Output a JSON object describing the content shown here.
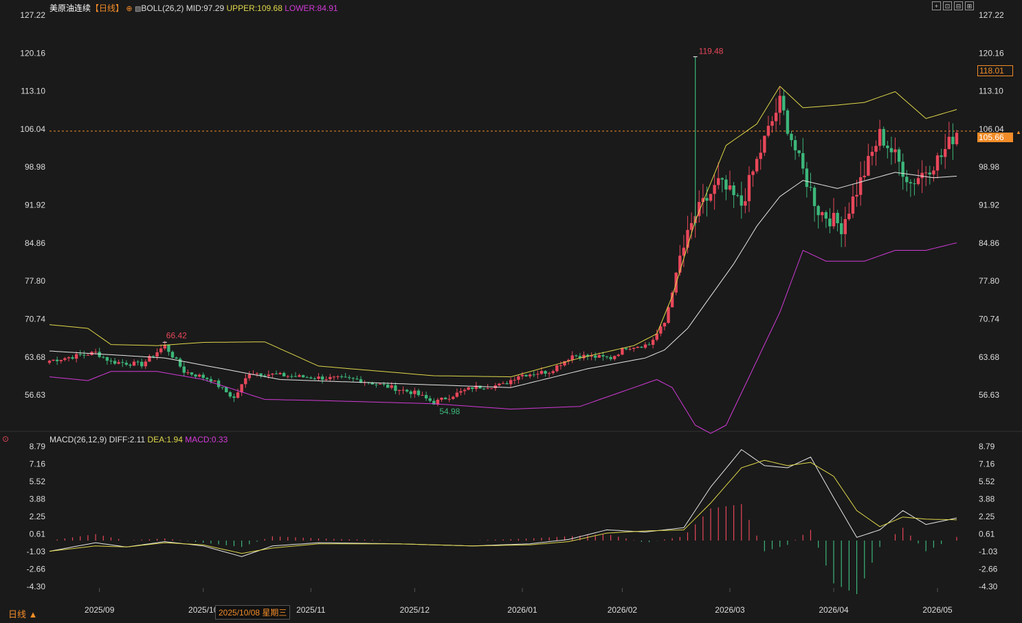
{
  "header": {
    "symbol": "美原油连续",
    "period_tag": "【日线】",
    "boll_label": "BOLL(26,2)",
    "mid": "MID:97.29",
    "upper": "UPPER:109.68",
    "lower": "LOWER:84.91",
    "macd_label": "MACD(26,12,9)",
    "diff": "DIFF:2.11",
    "dea": "DEA:1.94",
    "macd": "MACD:0.33"
  },
  "footer": {
    "timeframe": "日线 ▲",
    "cursor_date": "2025/10/08 星期三"
  },
  "colors": {
    "up": "#e8475a",
    "down": "#3cb67a",
    "mid": "#e8e8e8",
    "upper": "#e0d84a",
    "lower": "#d23ad8",
    "current": "#f28c28",
    "grid": "#2a2a2a"
  },
  "price_tags": {
    "high_label": "118.01",
    "last_label": "105.66",
    "max_marker": "119.48",
    "min_marker": "54.98",
    "local_high": "66.42"
  },
  "chart_data": [
    {
      "type": "candlestick",
      "y_ticks": [
        "127.22",
        "120.16",
        "113.10",
        "106.04",
        "98.98",
        "91.92",
        "84.86",
        "77.80",
        "70.74",
        "63.68",
        "56.63"
      ],
      "ylim": [
        52.5,
        127.22
      ],
      "x_ticks": [
        "2025/09",
        "2025/10",
        "2025/11",
        "2025/12",
        "2026/01",
        "2026/02",
        "2026/03",
        "2026/04",
        "2026/05"
      ],
      "last_price": 105.66,
      "waypoints": [
        [
          0,
          63.0
        ],
        [
          12,
          64.5
        ],
        [
          16,
          62.8
        ],
        [
          24,
          62.3
        ],
        [
          30,
          65.8
        ],
        [
          35,
          61.0
        ],
        [
          42,
          59.5
        ],
        [
          48,
          56.0
        ],
        [
          52,
          60.8
        ],
        [
          65,
          60.0
        ],
        [
          80,
          59.5
        ],
        [
          95,
          57.0
        ],
        [
          100,
          55.2
        ],
        [
          110,
          58.0
        ],
        [
          118,
          58.5
        ],
        [
          122,
          60.3
        ],
        [
          130,
          61.0
        ],
        [
          136,
          64.0
        ],
        [
          146,
          63.5
        ],
        [
          150,
          65.5
        ],
        [
          156,
          66.0
        ],
        [
          160,
          70.0
        ],
        [
          164,
          82.0
        ],
        [
          168,
          90.0
        ],
        [
          174,
          96.0
        ],
        [
          180,
          92.0
        ],
        [
          186,
          104.0
        ],
        [
          190,
          111.0
        ],
        [
          195,
          100.0
        ],
        [
          200,
          91.0
        ],
        [
          206,
          88.0
        ],
        [
          212,
          98.0
        ],
        [
          216,
          105.0
        ],
        [
          220,
          101.0
        ],
        [
          224,
          96.0
        ],
        [
          232,
          101.0
        ],
        [
          236,
          105.66
        ]
      ],
      "series": [
        {
          "name": "MID",
          "points": [
            [
              0,
              64.8
            ],
            [
              30,
              63.5
            ],
            [
              60,
              59.5
            ],
            [
              100,
              58.5
            ],
            [
              120,
              58.0
            ],
            [
              140,
              61.5
            ],
            [
              155,
              63.5
            ],
            [
              160,
              65.0
            ],
            [
              166,
              69.0
            ],
            [
              172,
              75.0
            ],
            [
              178,
              81.0
            ],
            [
              184,
              88.0
            ],
            [
              190,
              93.5
            ],
            [
              196,
              96.5
            ],
            [
              205,
              95.0
            ],
            [
              215,
              97.0
            ],
            [
              220,
              98.0
            ],
            [
              230,
              97.0
            ],
            [
              236,
              97.29
            ]
          ]
        },
        {
          "name": "UPPER",
          "points": [
            [
              0,
              69.7
            ],
            [
              10,
              69.0
            ],
            [
              16,
              66.0
            ],
            [
              28,
              65.8
            ],
            [
              40,
              66.4
            ],
            [
              56,
              66.5
            ],
            [
              70,
              62.0
            ],
            [
              100,
              60.2
            ],
            [
              120,
              60.0
            ],
            [
              138,
              63.5
            ],
            [
              152,
              65.8
            ],
            [
              158,
              68.0
            ],
            [
              162,
              75.0
            ],
            [
              168,
              89.0
            ],
            [
              176,
              103.0
            ],
            [
              184,
              107.0
            ],
            [
              190,
              114.0
            ],
            [
              196,
              110.0
            ],
            [
              205,
              110.5
            ],
            [
              212,
              111.0
            ],
            [
              220,
              113.0
            ],
            [
              228,
              108.0
            ],
            [
              236,
              109.68
            ]
          ]
        },
        {
          "name": "LOWER",
          "points": [
            [
              0,
              60.0
            ],
            [
              10,
              59.3
            ],
            [
              16,
              61.0
            ],
            [
              28,
              61.0
            ],
            [
              40,
              59.5
            ],
            [
              56,
              55.8
            ],
            [
              70,
              55.6
            ],
            [
              100,
              55.0
            ],
            [
              120,
              54.0
            ],
            [
              138,
              54.5
            ],
            [
              150,
              57.5
            ],
            [
              158,
              59.5
            ],
            [
              162,
              58.0
            ],
            [
              168,
              51.0
            ],
            [
              172,
              49.5
            ],
            [
              176,
              51.0
            ],
            [
              182,
              60.0
            ],
            [
              190,
              72.0
            ],
            [
              196,
              83.5
            ],
            [
              202,
              81.5
            ],
            [
              212,
              81.5
            ],
            [
              220,
              83.5
            ],
            [
              228,
              83.5
            ],
            [
              236,
              84.91
            ]
          ]
        }
      ]
    },
    {
      "type": "macd",
      "y_ticks": [
        "8.79",
        "7.16",
        "5.52",
        "3.88",
        "2.25",
        "0.61",
        "-1.03",
        "-2.66",
        "-4.30"
      ],
      "ylim": [
        -5.6,
        8.79
      ],
      "series": [
        {
          "name": "DIFF",
          "points": [
            [
              0,
              -1.0
            ],
            [
              12,
              -0.2
            ],
            [
              20,
              -0.6
            ],
            [
              30,
              -0.1
            ],
            [
              40,
              -0.5
            ],
            [
              50,
              -1.5
            ],
            [
              58,
              -0.5
            ],
            [
              70,
              -0.2
            ],
            [
              90,
              -0.3
            ],
            [
              100,
              -0.4
            ],
            [
              110,
              -0.5
            ],
            [
              125,
              -0.3
            ],
            [
              135,
              0.1
            ],
            [
              145,
              1.0
            ],
            [
              155,
              0.8
            ],
            [
              165,
              1.2
            ],
            [
              172,
              5.0
            ],
            [
              180,
              8.5
            ],
            [
              186,
              7.0
            ],
            [
              192,
              6.8
            ],
            [
              198,
              7.8
            ],
            [
              204,
              4.0
            ],
            [
              210,
              0.3
            ],
            [
              216,
              1.0
            ],
            [
              222,
              2.8
            ],
            [
              228,
              1.5
            ],
            [
              236,
              2.11
            ]
          ]
        },
        {
          "name": "DEA",
          "points": [
            [
              0,
              -1.0
            ],
            [
              12,
              -0.5
            ],
            [
              20,
              -0.6
            ],
            [
              30,
              -0.2
            ],
            [
              40,
              -0.4
            ],
            [
              50,
              -1.2
            ],
            [
              58,
              -0.7
            ],
            [
              70,
              -0.3
            ],
            [
              90,
              -0.3
            ],
            [
              100,
              -0.4
            ],
            [
              110,
              -0.5
            ],
            [
              125,
              -0.4
            ],
            [
              135,
              -0.1
            ],
            [
              145,
              0.7
            ],
            [
              155,
              0.9
            ],
            [
              165,
              1.0
            ],
            [
              172,
              3.5
            ],
            [
              180,
              6.8
            ],
            [
              186,
              7.5
            ],
            [
              192,
              7.0
            ],
            [
              198,
              7.3
            ],
            [
              204,
              6.0
            ],
            [
              210,
              2.8
            ],
            [
              216,
              1.3
            ],
            [
              222,
              2.2
            ],
            [
              228,
              2.0
            ],
            [
              236,
              1.94
            ]
          ]
        }
      ]
    }
  ]
}
